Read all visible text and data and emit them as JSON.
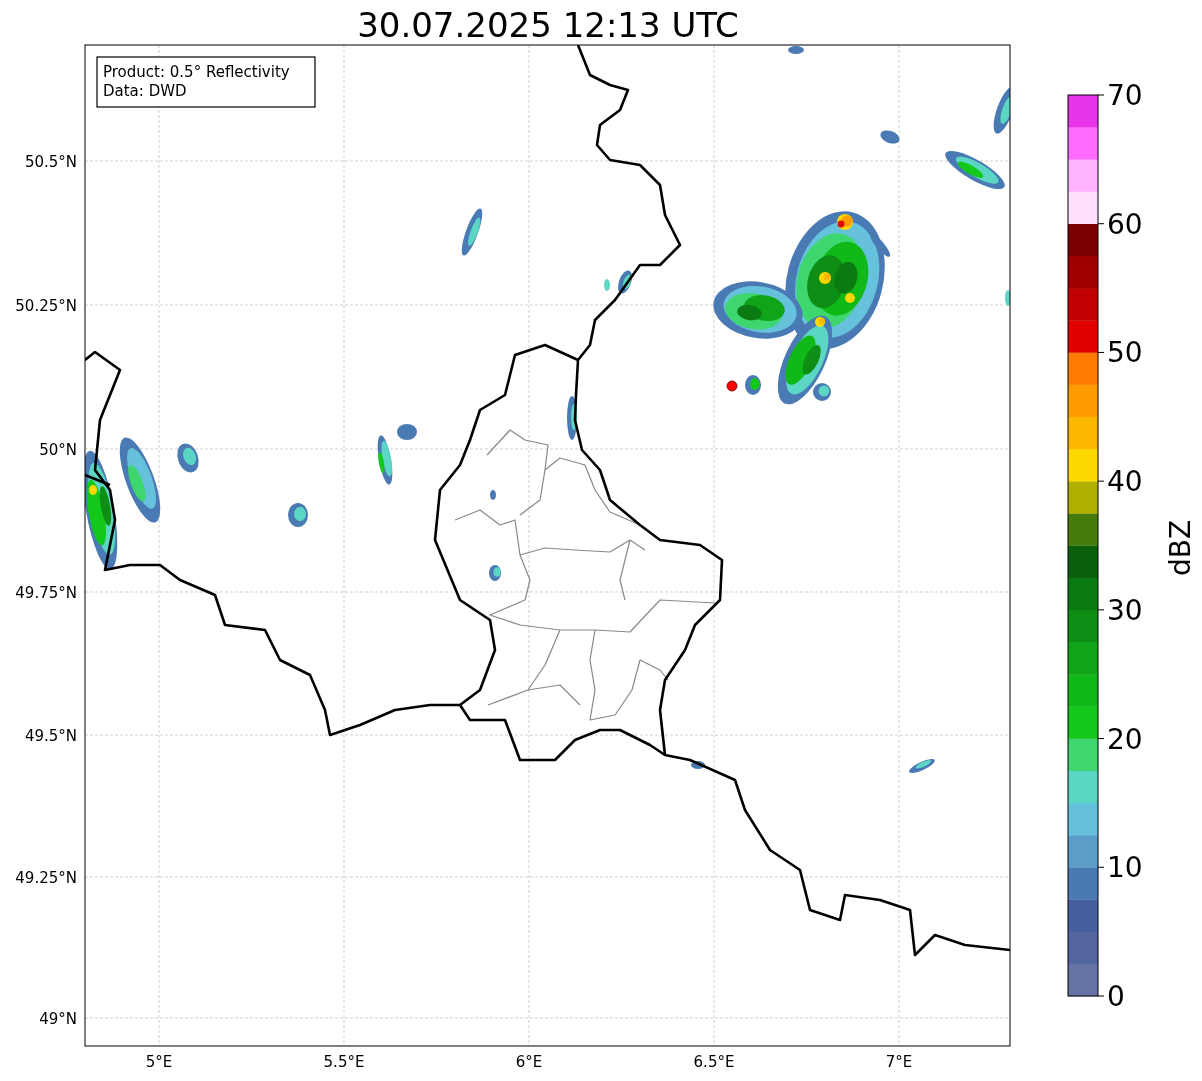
{
  "title": "30.07.2025 12:13 UTC",
  "info_box": {
    "lines": [
      "Product: 0.5° Reflectivity",
      "Data: DWD"
    ]
  },
  "map": {
    "lat_ticks": [
      "50.5°N",
      "50.25°N",
      "50°N",
      "49.75°N",
      "49.5°N",
      "49.25°N",
      "49°N"
    ],
    "lon_ticks": [
      "5°E",
      "5.5°E",
      "6°E",
      "6.5°E",
      "7°E"
    ]
  },
  "colorbar": {
    "label": "dBZ",
    "ticks": [
      "70",
      "60",
      "50",
      "40",
      "30",
      "20",
      "10",
      "0"
    ],
    "bands": [
      {
        "color": "#6673a6"
      },
      {
        "color": "#5466a0"
      },
      {
        "color": "#445ea0"
      },
      {
        "color": "#4a7ab4"
      },
      {
        "color": "#5a9ec8"
      },
      {
        "color": "#66c2dc"
      },
      {
        "color": "#5cd6c4"
      },
      {
        "color": "#3ed66e"
      },
      {
        "color": "#12c81a"
      },
      {
        "color": "#10b818"
      },
      {
        "color": "#10a418"
      },
      {
        "color": "#0e8e14"
      },
      {
        "color": "#0c7a12"
      },
      {
        "color": "#0a5e0e"
      },
      {
        "color": "#467a0a"
      },
      {
        "color": "#b0b000"
      },
      {
        "color": "#ffd800"
      },
      {
        "color": "#ffb800"
      },
      {
        "color": "#ff9c00"
      },
      {
        "color": "#ff7c00"
      },
      {
        "color": "#e00000"
      },
      {
        "color": "#c00000"
      },
      {
        "color": "#a00000"
      },
      {
        "color": "#780000"
      },
      {
        "color": "#ffe0ff"
      },
      {
        "color": "#ffb4ff"
      },
      {
        "color": "#ff6cff"
      },
      {
        "color": "#e834e8"
      }
    ]
  }
}
